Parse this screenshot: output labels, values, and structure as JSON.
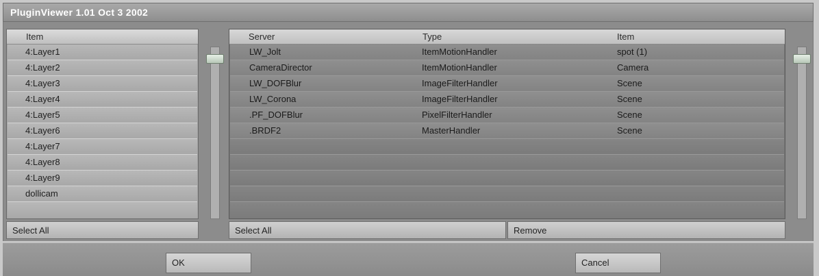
{
  "window": {
    "title": "PluginViewer 1.01 Oct  3 2002"
  },
  "left_list": {
    "header": "Item",
    "items": [
      "4:Layer1",
      "4:Layer2",
      "4:Layer3",
      "4:Layer4",
      "4:Layer5",
      "4:Layer6",
      "4:Layer7",
      "4:Layer8",
      "4:Layer9",
      "dollicam"
    ],
    "select_all_label": "Select All"
  },
  "right_table": {
    "headers": {
      "server": "Server",
      "type": "Type",
      "item": "Item"
    },
    "rows": [
      {
        "server": "LW_Jolt",
        "type": "ItemMotionHandler",
        "item": "spot (1)"
      },
      {
        "server": "CameraDirector",
        "type": "ItemMotionHandler",
        "item": "Camera"
      },
      {
        "server": "LW_DOFBlur",
        "type": "ImageFilterHandler",
        "item": "Scene"
      },
      {
        "server": "LW_Corona",
        "type": "ImageFilterHandler",
        "item": "Scene"
      },
      {
        "server": ".PF_DOFBlur",
        "type": "PixelFilterHandler",
        "item": "Scene"
      },
      {
        "server": ".BRDF2",
        "type": "MasterHandler",
        "item": "Scene"
      }
    ],
    "select_all_label": "Select All",
    "remove_label": "Remove"
  },
  "footer": {
    "ok_label": "OK",
    "cancel_label": "Cancel"
  },
  "colors": {
    "panel": "#8c8c8c",
    "title_text": "#ffffff",
    "scroll_thumb": "#d4e0d4"
  }
}
